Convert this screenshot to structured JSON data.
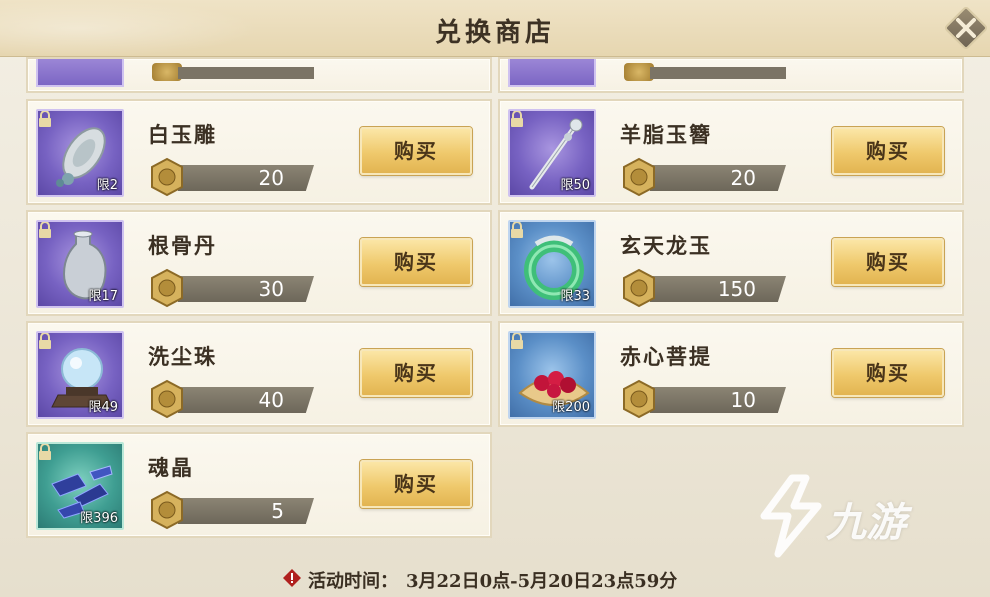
{
  "header": {
    "title": "兑换商店"
  },
  "items": [
    {
      "name": "白玉雕",
      "price": "20",
      "limit": "限2",
      "buy_label": "购买",
      "icon": "jade-carving-icon"
    },
    {
      "name": "羊脂玉簪",
      "price": "20",
      "limit": "限50",
      "buy_label": "购买",
      "icon": "jade-hairpin-icon"
    },
    {
      "name": "根骨丹",
      "price": "30",
      "limit": "限17",
      "buy_label": "购买",
      "icon": "vase-icon"
    },
    {
      "name": "玄天龙玉",
      "price": "150",
      "limit": "限33",
      "buy_label": "购买",
      "icon": "dragon-jade-icon"
    },
    {
      "name": "洗尘珠",
      "price": "40",
      "limit": "限49",
      "buy_label": "购买",
      "icon": "crystal-ball-icon"
    },
    {
      "name": "赤心菩提",
      "price": "10",
      "limit": "限200",
      "buy_label": "购买",
      "icon": "red-beads-icon"
    },
    {
      "name": "魂晶",
      "price": "5",
      "limit": "限396",
      "buy_label": "购买",
      "icon": "soul-crystal-icon"
    }
  ],
  "footer": {
    "label": "活动时间：",
    "time": "3月22日0点-5月20日23点59分"
  },
  "watermark": {
    "text": "九游"
  }
}
